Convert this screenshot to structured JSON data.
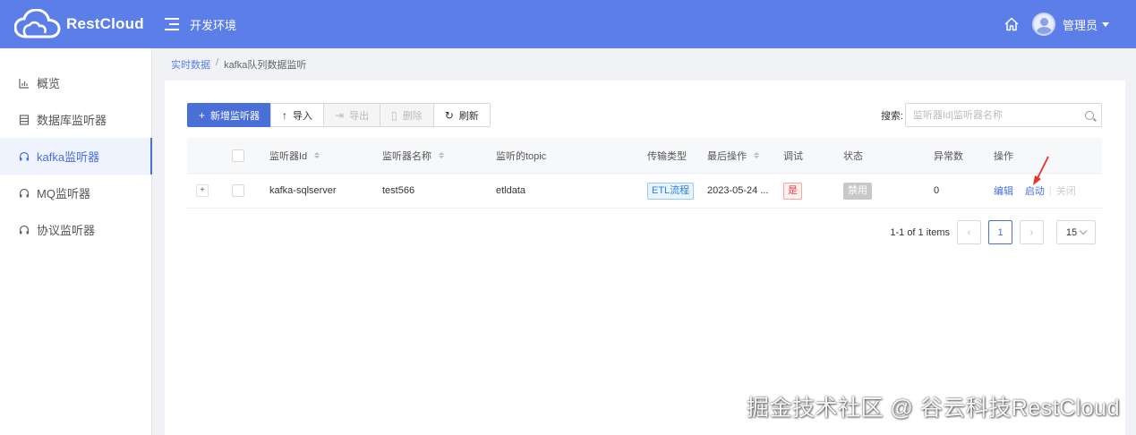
{
  "header": {
    "brand": "RestCloud",
    "env_title": "开发环境",
    "user_name": "管理员"
  },
  "sidebar": {
    "items": [
      {
        "label": "概览",
        "icon": "bar-chart-icon"
      },
      {
        "label": "数据库监听器",
        "icon": "database-icon"
      },
      {
        "label": "kafka监听器",
        "icon": "headset-icon"
      },
      {
        "label": "MQ监听器",
        "icon": "headset-icon"
      },
      {
        "label": "协议监听器",
        "icon": "headset-icon"
      }
    ],
    "active_index": 2
  },
  "breadcrumb": {
    "parent": "实时数据",
    "separator": "/",
    "current": "kafka队列数据监听"
  },
  "toolbar": {
    "new_label": "新增监听器",
    "import_label": "导入",
    "export_label": "导出",
    "delete_label": "删除",
    "refresh_label": "刷新"
  },
  "search": {
    "label": "搜索:",
    "placeholder": "监听器Id|监听器名称"
  },
  "table": {
    "columns": [
      "监听器Id",
      "监听器名称",
      "监听的topic",
      "传输类型",
      "最后操作",
      "调试",
      "状态",
      "异常数",
      "操作"
    ],
    "rows": [
      {
        "expand": "+",
        "id": "kafka-sqlserver",
        "name": "test566",
        "topic": "etldata",
        "transfer_type": "ETL流程",
        "last_op": "2023-05-24 ...",
        "debug": "是",
        "status": "禁用",
        "errors": "0",
        "actions": {
          "edit": "编辑",
          "start": "启动",
          "close": "关闭"
        }
      }
    ]
  },
  "pagination": {
    "summary": "1-1 of 1 items",
    "prev": "‹",
    "current": "1",
    "next": "›",
    "page_size": "15"
  },
  "watermark": "掘金技术社区 @ 谷云科技RestCloud",
  "colors": {
    "header_bg": "#5b7ee8",
    "primary": "#4a6fd6",
    "annotation_arrow": "#e8312f"
  }
}
